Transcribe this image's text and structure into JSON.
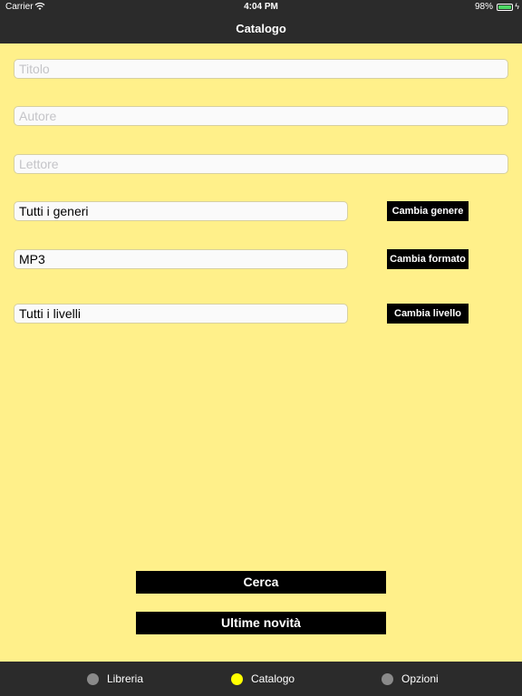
{
  "status_bar": {
    "carrier": "Carrier",
    "time": "4:04 PM",
    "battery": "98%"
  },
  "nav": {
    "title": "Catalogo"
  },
  "form": {
    "title_placeholder": "Titolo",
    "author_placeholder": "Autore",
    "reader_placeholder": "Lettore",
    "genre_value": "Tutti i generi",
    "genre_button": "Cambia genere",
    "format_value": "MP3",
    "format_button": "Cambia formato",
    "level_value": "Tutti i livelli",
    "level_button": "Cambia livello"
  },
  "actions": {
    "search": "Cerca",
    "latest": "Ultime novità"
  },
  "tabs": [
    {
      "label": "Libreria",
      "icon": "circle-icon",
      "active": false
    },
    {
      "label": "Catalogo",
      "icon": "circle-icon",
      "active": true
    },
    {
      "label": "Opzioni",
      "icon": "circle-icon",
      "active": false
    }
  ],
  "colors": {
    "background": "#fff08a",
    "bar": "#2b2b2b",
    "active_tab": "#ffff00",
    "inactive_tab": "#8a8a8a",
    "button": "#000000"
  }
}
